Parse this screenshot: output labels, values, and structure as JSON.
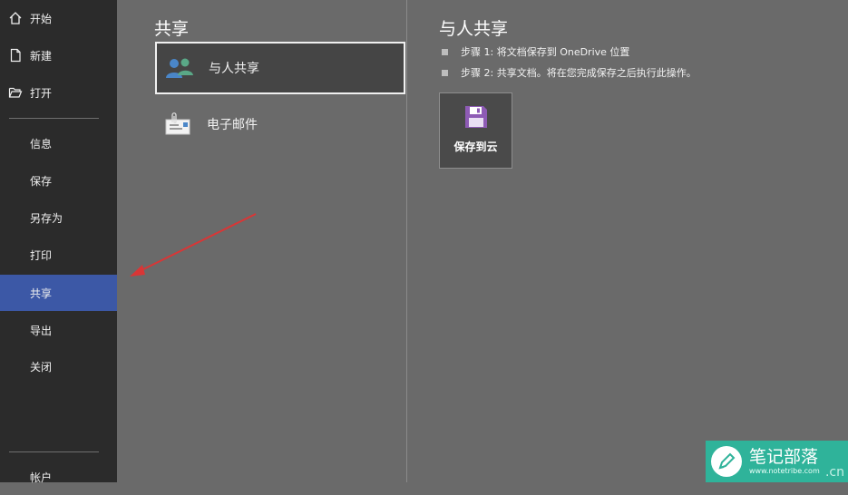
{
  "sidebar": {
    "top_items": [
      {
        "label": "开始",
        "icon": "home-icon"
      },
      {
        "label": "新建",
        "icon": "new-document-icon"
      },
      {
        "label": "打开",
        "icon": "open-folder-icon"
      }
    ],
    "items": [
      {
        "label": "信息"
      },
      {
        "label": "保存"
      },
      {
        "label": "另存为"
      },
      {
        "label": "打印"
      },
      {
        "label": "共享"
      },
      {
        "label": "导出"
      },
      {
        "label": "关闭"
      }
    ],
    "active_item": "共享",
    "account_label": "帐户",
    "active_color": "#3c58a6"
  },
  "share_panel": {
    "title": "共享",
    "options": [
      {
        "label": "与人共享",
        "icon": "people-share-icon",
        "selected": true
      },
      {
        "label": "电子邮件",
        "icon": "email-attachment-icon",
        "selected": false
      }
    ]
  },
  "detail_panel": {
    "title": "与人共享",
    "steps": [
      "步骤 1: 将文档保存到 OneDrive 位置",
      "步骤 2: 共享文档。将在您完成保存之后执行此操作。"
    ],
    "save_button_label": "保存到云",
    "save_icon": "floppy-disk-icon",
    "save_icon_color": "#8e5bb5"
  },
  "watermark": {
    "name": "笔记部落",
    "url": "www.notetribe.com",
    "suffix": ".cn",
    "color": "#2fb39a"
  }
}
